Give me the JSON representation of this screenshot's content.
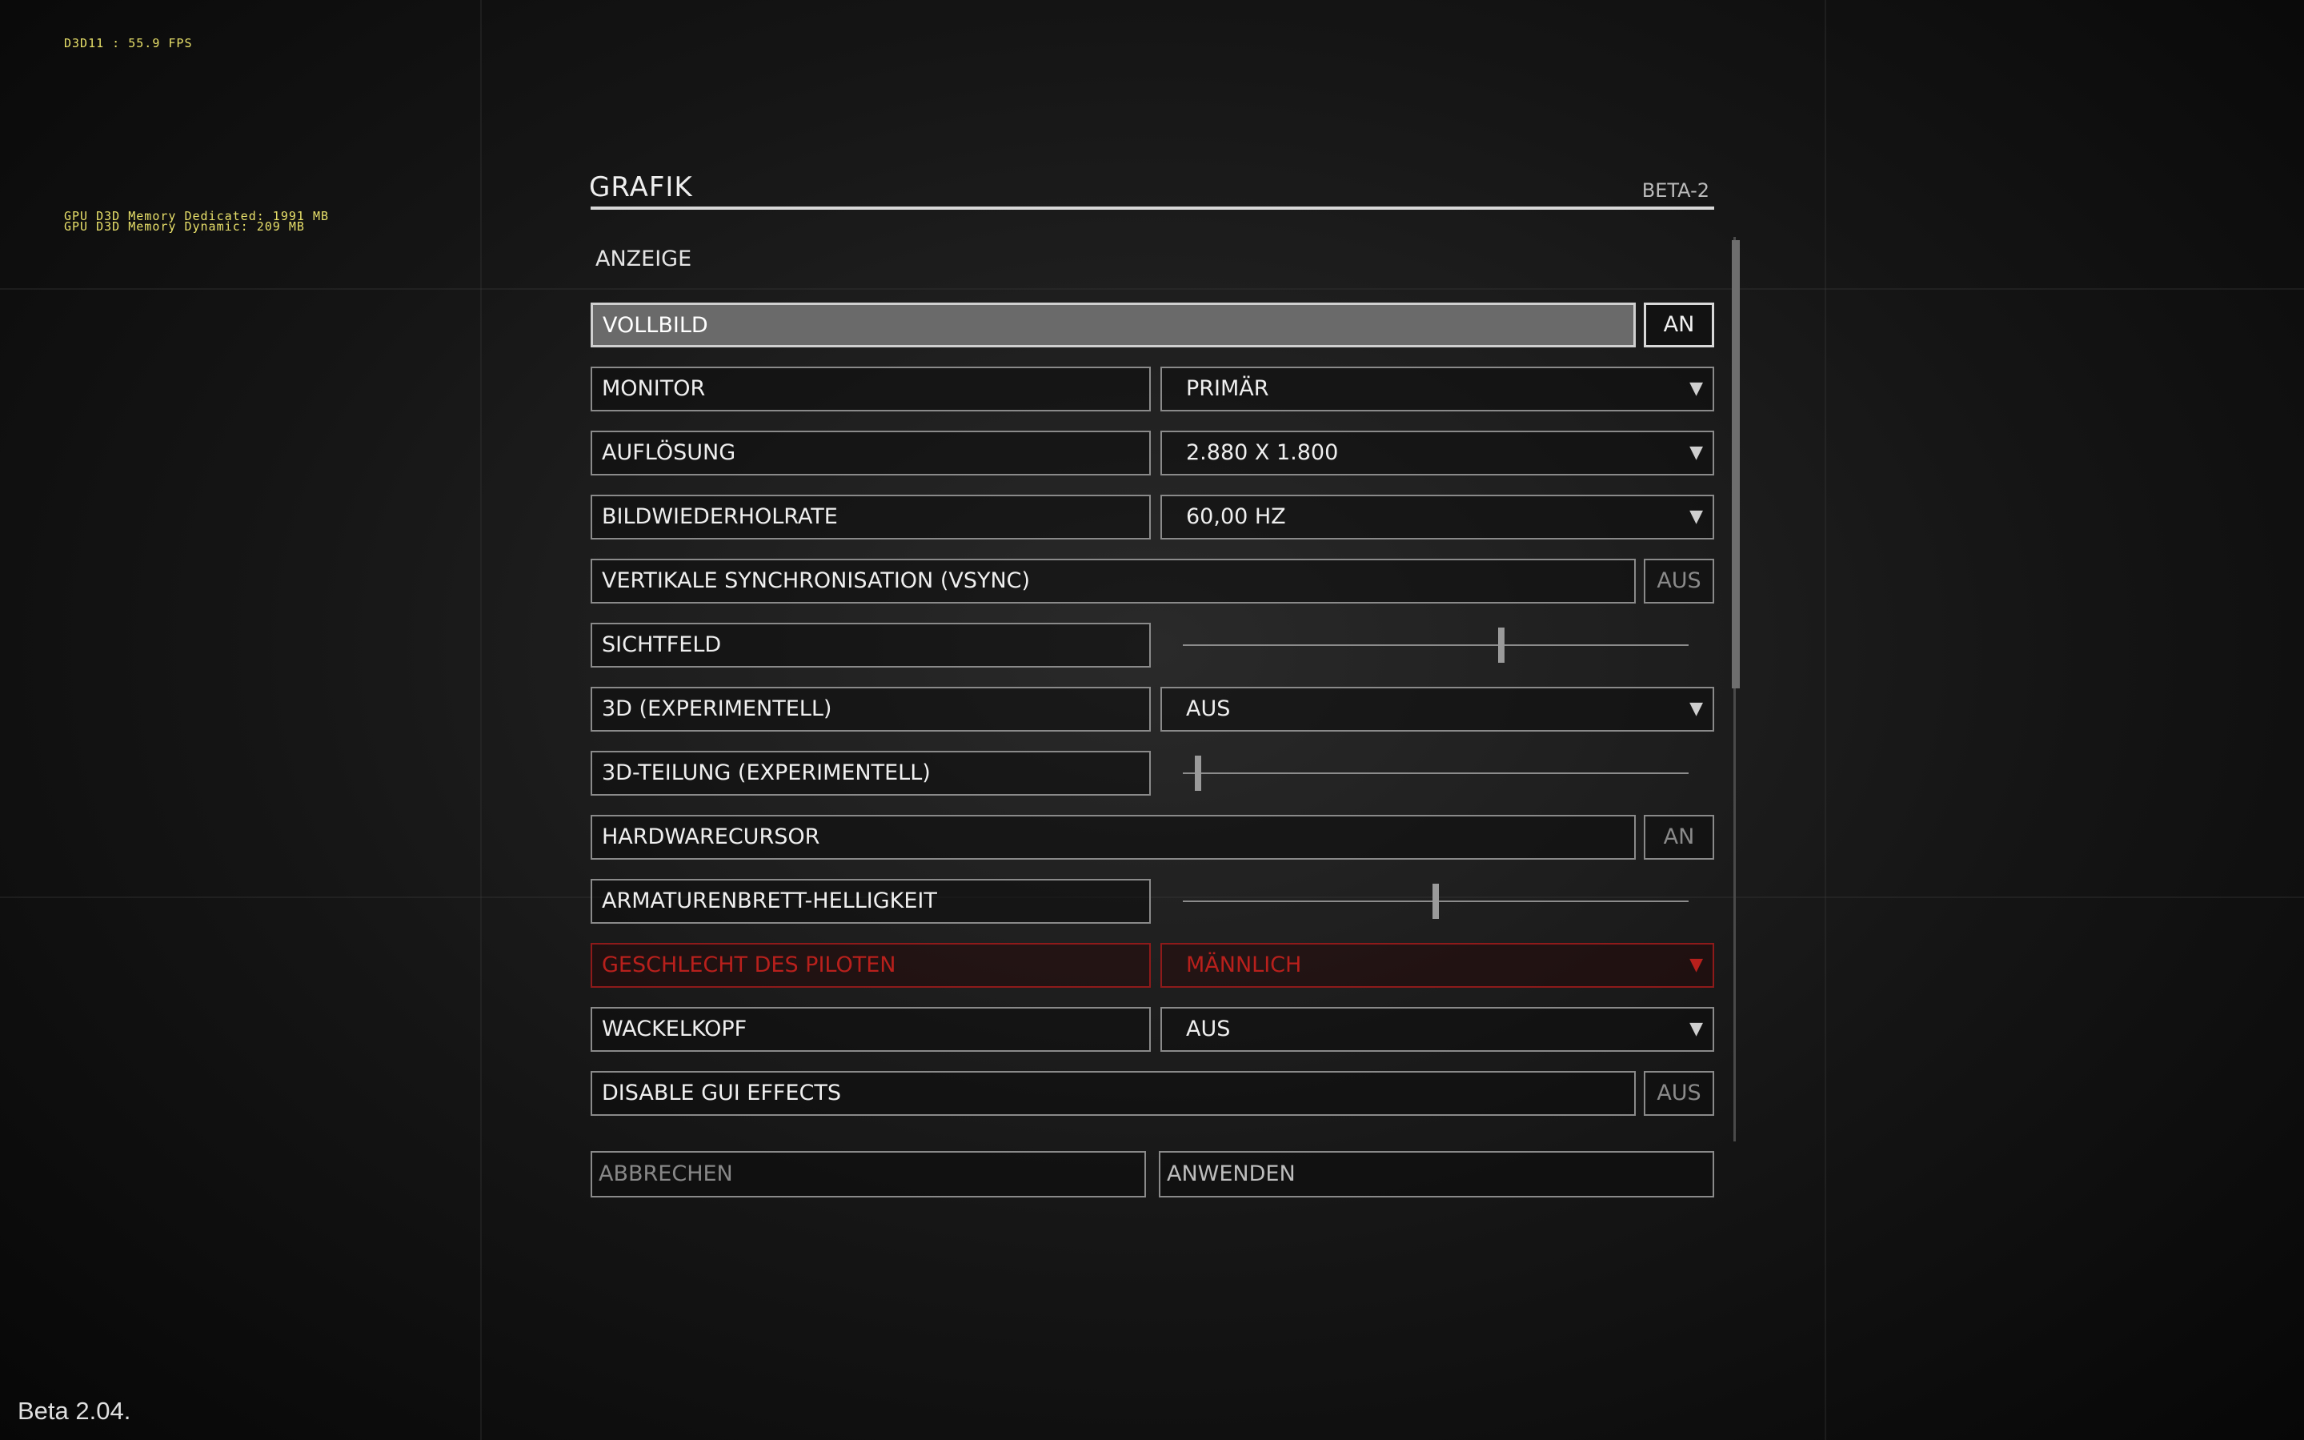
{
  "debug": {
    "renderer": "D3D11   : 55.9 FPS",
    "gpu_dedicated": "GPU D3D Memory Dedicated: 1991 MB",
    "gpu_dynamic": "GPU D3D Memory Dynamic: 209 MB"
  },
  "panel": {
    "title": "GRAFIK",
    "build_tag": "BETA-2",
    "section": "ANZEIGE"
  },
  "settings": {
    "fullscreen": {
      "label": "VOLLBILD",
      "value": "AN"
    },
    "monitor": {
      "label": "MONITOR",
      "value": "PRIMÄR"
    },
    "resolution": {
      "label": "AUFLÖSUNG",
      "value": "2.880 X 1.800"
    },
    "refresh_rate": {
      "label": "BILDWIEDERHOLRATE",
      "value": "60,00 HZ"
    },
    "vsync": {
      "label": "VERTIKALE SYNCHRONISATION (VSYNC)",
      "value": "AUS"
    },
    "fov": {
      "label": "SICHTFELD",
      "level": 0.63
    },
    "stereo3d": {
      "label": "3D (EXPERIMENTELL)",
      "value": "AUS"
    },
    "stereo_separation": {
      "label": "3D-TEILUNG (EXPERIMENTELL)",
      "level": 0.03
    },
    "hardware_cursor": {
      "label": "HARDWARECURSOR",
      "value": "AN"
    },
    "dashboard_brightness": {
      "label": "ARMATURENBRETT-HELLIGKEIT",
      "level": 0.5
    },
    "pilot_gender": {
      "label": "GESCHLECHT DES PILOTEN",
      "value": "MÄNNLICH"
    },
    "head_bob": {
      "label": "WACKELKOPF",
      "value": "AUS"
    },
    "gui_effects": {
      "label": "DISABLE GUI EFFECTS",
      "value": "AUS"
    }
  },
  "buttons": {
    "cancel": "ABBRECHEN",
    "apply": "ANWENDEN"
  },
  "version": "Beta 2.04.",
  "colors": {
    "disabled_red": "#b8201c",
    "selected_row": "#6a6a6a",
    "debug_yellow": "#e8e06a"
  }
}
